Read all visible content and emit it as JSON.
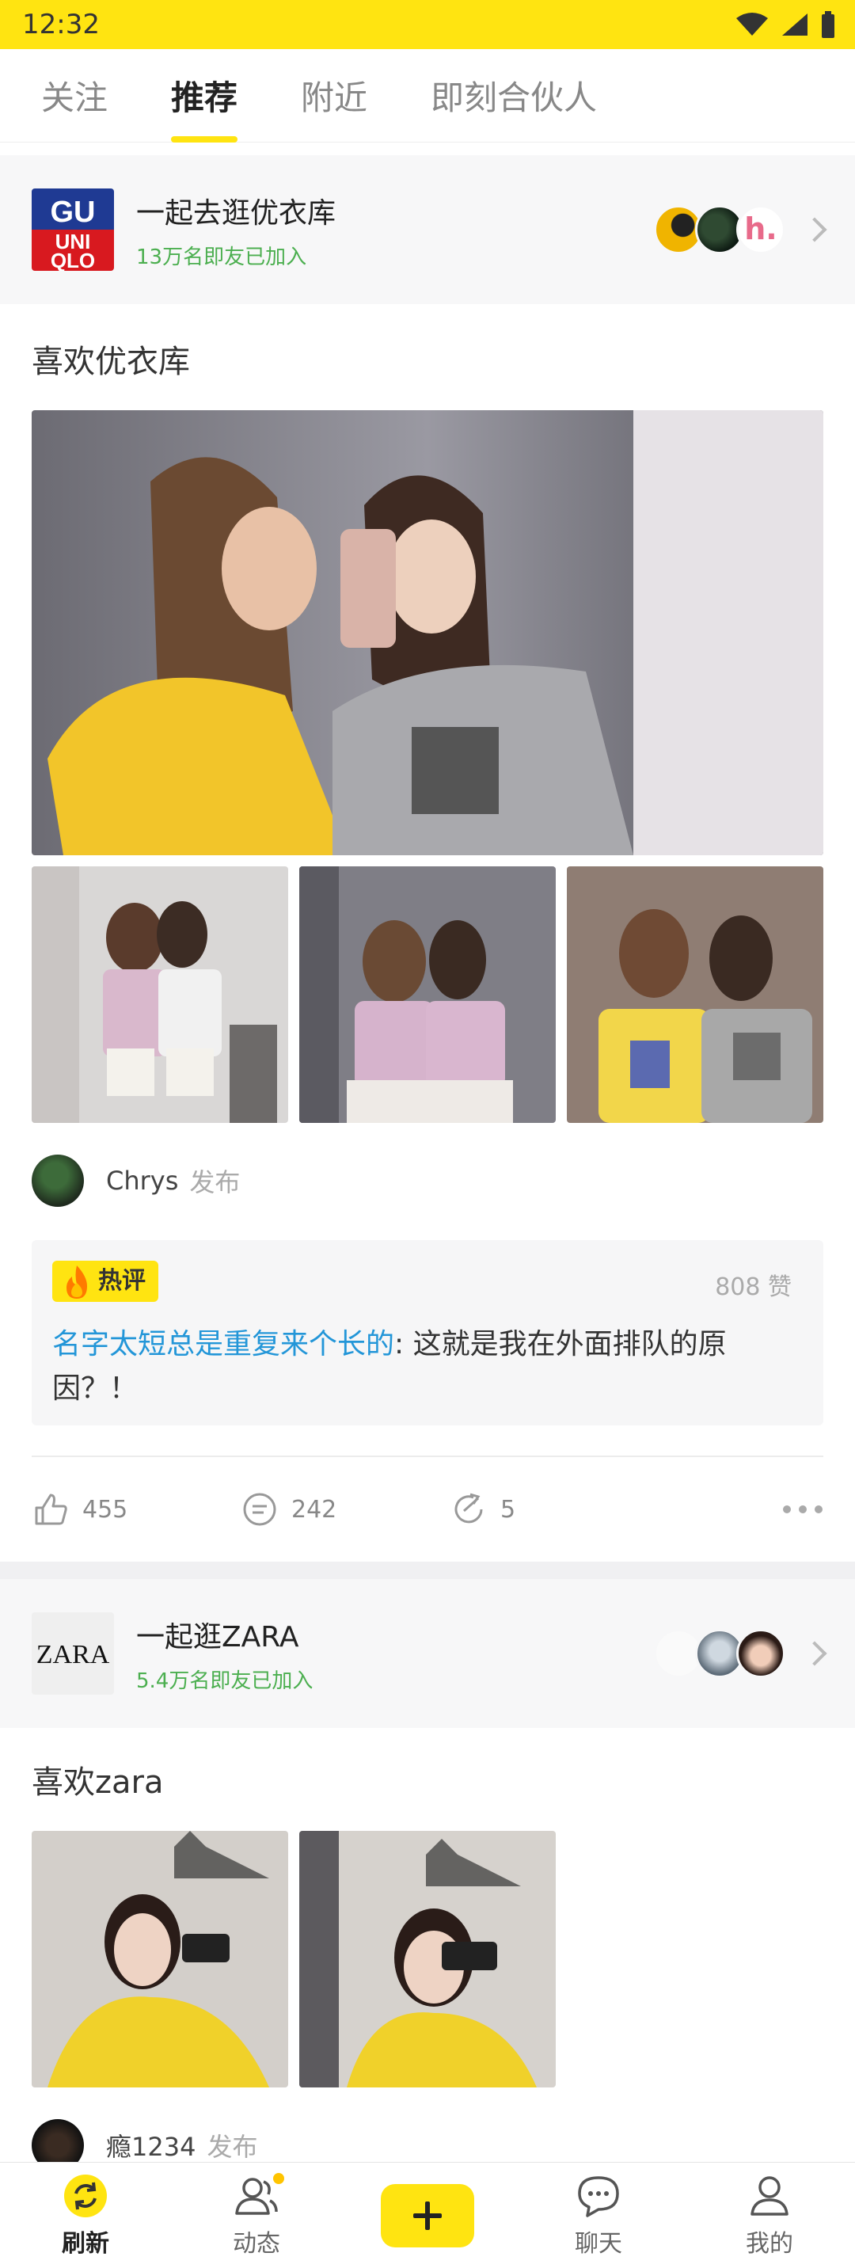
{
  "status_bar": {
    "time": "12:32"
  },
  "tabs": [
    {
      "label": "关注",
      "active": false
    },
    {
      "label": "推荐",
      "active": true
    },
    {
      "label": "附近",
      "active": false
    },
    {
      "label": "即刻合伙人",
      "active": false
    }
  ],
  "topics": [
    {
      "name": "一起去逛优衣库",
      "member_count": "13万名即友已加入",
      "logo": {
        "line1": "GU",
        "line2": "UNI",
        "line3": "QLO"
      }
    },
    {
      "name": "一起逛ZARA",
      "member_count": "5.4万名即友已加入",
      "logo": {
        "text": "ZARA"
      }
    }
  ],
  "post1": {
    "title": "喜欢优衣库",
    "author": "Chrys",
    "action": "发布",
    "hot_comment": {
      "badge": "热评",
      "likes": "808 赞",
      "user": "名字太短总是重复来个长的",
      "text": ": 这就是我在外面排队的原因？！"
    },
    "likes": "455",
    "comments": "242",
    "shares": "5"
  },
  "post2": {
    "title": "喜欢zara",
    "author": "瘾1234",
    "action": "发布"
  },
  "bottom_nav": [
    {
      "label": "刷新",
      "icon": "refresh-icon",
      "active": true
    },
    {
      "label": "动态",
      "icon": "people-icon",
      "active": false
    },
    {
      "label": "",
      "icon": "plus-icon",
      "active": false
    },
    {
      "label": "聊天",
      "icon": "chat-icon",
      "active": false
    },
    {
      "label": "我的",
      "icon": "profile-icon",
      "active": false
    }
  ],
  "colors": {
    "brand_yellow": "#FFE411",
    "link_blue": "#2396D8",
    "member_green": "#4CAF50"
  }
}
